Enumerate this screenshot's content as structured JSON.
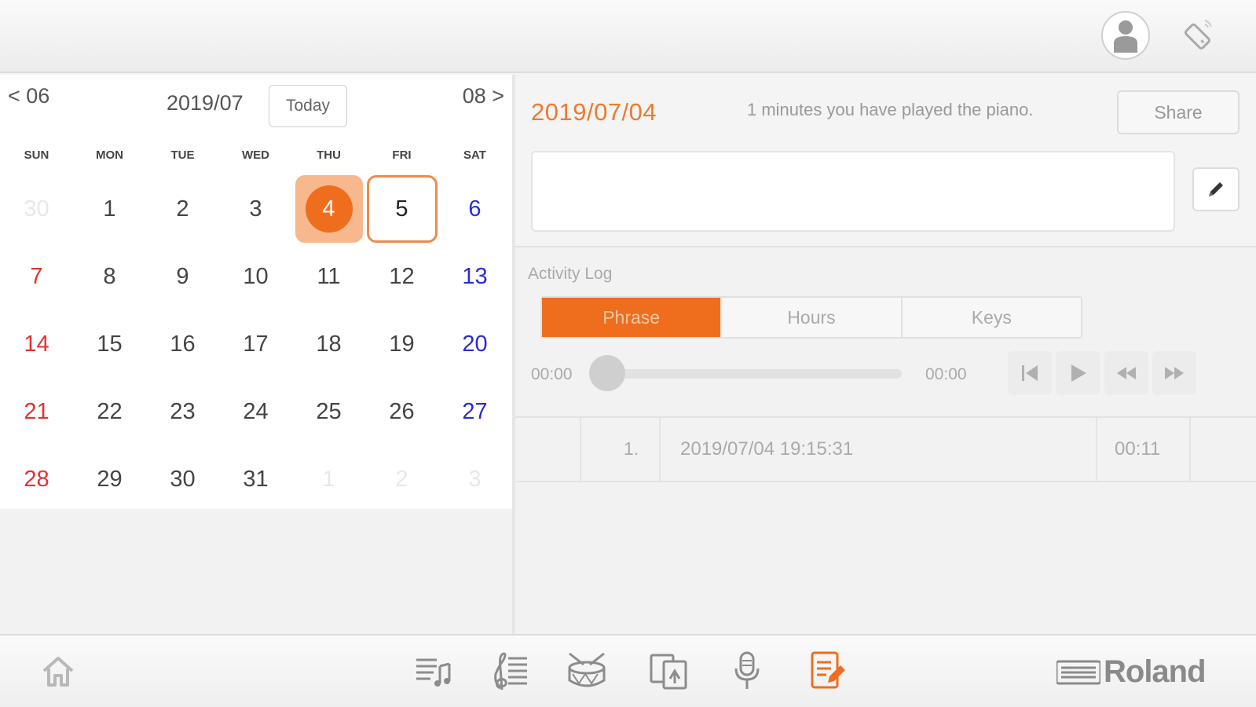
{
  "header": {
    "icons": [
      "user-icon",
      "bluetooth-icon"
    ]
  },
  "calendar": {
    "prev_label": "< 06",
    "month_label": "2019/07",
    "next_label": "08 >",
    "today_label": "Today",
    "weekdays": [
      "SUN",
      "MON",
      "TUE",
      "WED",
      "THU",
      "FRI",
      "SAT"
    ],
    "selected_day": "4",
    "today_day": "5",
    "colors": {
      "selected": "#ee6e1e",
      "sunday": "#e53030",
      "saturday": "#2b2bd8"
    },
    "days": [
      {
        "label": "30",
        "kind": "other"
      },
      {
        "label": "1",
        "kind": "mon"
      },
      {
        "label": "2",
        "kind": "tue"
      },
      {
        "label": "3",
        "kind": "wed"
      },
      {
        "label": "4",
        "kind": "selected"
      },
      {
        "label": "5",
        "kind": "today"
      },
      {
        "label": "6",
        "kind": "sat"
      },
      {
        "label": "7",
        "kind": "sun"
      },
      {
        "label": "8",
        "kind": "mon"
      },
      {
        "label": "9",
        "kind": "tue"
      },
      {
        "label": "10",
        "kind": "wed"
      },
      {
        "label": "11",
        "kind": "thu"
      },
      {
        "label": "12",
        "kind": "fri"
      },
      {
        "label": "13",
        "kind": "sat"
      },
      {
        "label": "14",
        "kind": "sun"
      },
      {
        "label": "15",
        "kind": "mon"
      },
      {
        "label": "16",
        "kind": "tue"
      },
      {
        "label": "17",
        "kind": "wed"
      },
      {
        "label": "18",
        "kind": "thu"
      },
      {
        "label": "19",
        "kind": "fri"
      },
      {
        "label": "20",
        "kind": "sat"
      },
      {
        "label": "21",
        "kind": "sun"
      },
      {
        "label": "22",
        "kind": "mon"
      },
      {
        "label": "23",
        "kind": "tue"
      },
      {
        "label": "24",
        "kind": "wed"
      },
      {
        "label": "25",
        "kind": "thu"
      },
      {
        "label": "26",
        "kind": "fri"
      },
      {
        "label": "27",
        "kind": "sat"
      },
      {
        "label": "28",
        "kind": "sun"
      },
      {
        "label": "29",
        "kind": "mon"
      },
      {
        "label": "30",
        "kind": "tue"
      },
      {
        "label": "31",
        "kind": "wed"
      },
      {
        "label": "1",
        "kind": "other"
      },
      {
        "label": "2",
        "kind": "other"
      },
      {
        "label": "3",
        "kind": "other"
      }
    ]
  },
  "detail": {
    "date": "2019/07/04",
    "summary": "1 minutes you have played the piano.",
    "share_label": "Share",
    "memo": "",
    "edit_icon": "pencil-icon"
  },
  "activity": {
    "title": "Activity Log",
    "tabs": [
      "Phrase",
      "Hours",
      "Keys"
    ],
    "active_tab": "Phrase",
    "time_start": "00:00",
    "time_end": "00:00",
    "progress": 0,
    "controls": [
      "skip-back-icon",
      "play-icon",
      "rewind-icon",
      "fast-forward-icon"
    ]
  },
  "log": {
    "rows": [
      {
        "num": "1.",
        "datetime": "2019/07/04 19:15:31",
        "duration": "00:11"
      }
    ]
  },
  "footer": {
    "icons": [
      "home-icon",
      "song-list-icon",
      "score-icon",
      "rhythm-drum-icon",
      "flash-card-icon",
      "recorder-icon",
      "diary-icon"
    ],
    "active_icon": "diary-icon",
    "brand": "Roland"
  }
}
